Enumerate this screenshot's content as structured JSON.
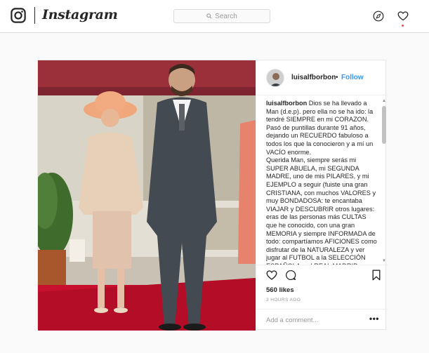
{
  "app": {
    "name": "Instagram"
  },
  "header": {
    "logo_text": "Instagram",
    "search_placeholder": "Search",
    "icons": [
      "instagram-logo-icon",
      "search-icon",
      "compass-icon",
      "heart-icon"
    ],
    "notification_dot_color": "#ed4956"
  },
  "post": {
    "author": "luisalfborbon",
    "separator": "•",
    "follow_label": "Follow",
    "caption_user": "luisalfborbon",
    "caption_text": " Dios se ha llevado a Man (d.e.p). pero ella no se ha ido: la tendré SIEMPRE en mi CORAZON.\nPasó de puntillas durante 91 años, dejando un RECUERDO fabuloso a todos los que la conocieron y a mí un VACÍO enorme.\nQuerida Man, siempre serás mi SUPER ABUELA, mi SEGUNDA MADRE, uno de mis PILARES, y mi EJEMPLO a seguir (fuiste una gran CRISTIANA, con muchos VALORES y muy BONDADOSA: te encantaba VIAJAR y DESCUBRIR otros lugares: eras de las personas más CULTAS que he conocido, con una gran MEMORIA y siempre INFORMADA de todo: compartíamos AFICIONES como disfrutar de la NATURALEZA y ver jugar al FUTBOL a la SELECCIÓN ESPAÑOLA o al REAL MADRID; me impresiona la GRAN SEÑORA que siempre fuiste, con tu SABER ESTAR , tu",
    "likes": "560 likes",
    "time": "3 HOURS AGO",
    "comment_placeholder": "Add a comment...",
    "more_label": "•••",
    "scrollbar": {
      "thumb_position": 0.04,
      "thumb_size": 0.23
    }
  },
  "colors": {
    "accent": "#3897f0",
    "border": "#dbdbdb",
    "text": "#262626",
    "muted": "#999999"
  }
}
